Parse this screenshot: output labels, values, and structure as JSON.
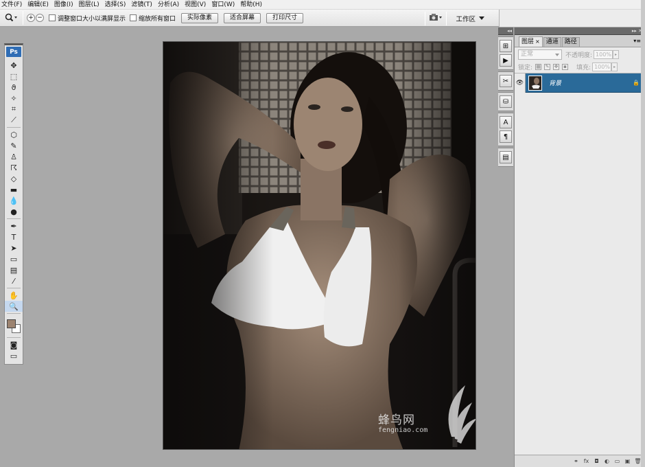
{
  "menu": [
    "文件(F)",
    "编辑(E)",
    "图像(I)",
    "图层(L)",
    "选择(S)",
    "滤镜(T)",
    "分析(A)",
    "视图(V)",
    "窗口(W)",
    "帮助(H)"
  ],
  "options": {
    "tool_icon": "zoom-icon",
    "zoom_in": "+",
    "zoom_out": "−",
    "resize_windows": "调整窗口大小以满屏显示",
    "zoom_all": "缩放所有窗口",
    "actual_pixels": "实际像素",
    "fit_screen": "适合屏幕",
    "print_size": "打印尺寸",
    "workspace": "工作区"
  },
  "toolbox": {
    "logo": "Ps",
    "tools": [
      {
        "name": "move-tool",
        "glyph": "✥"
      },
      {
        "name": "marquee-tool",
        "glyph": "⬚"
      },
      {
        "name": "lasso-tool",
        "glyph": "ϑ"
      },
      {
        "name": "magic-wand-tool",
        "glyph": "✧"
      },
      {
        "name": "crop-tool",
        "glyph": "⌗"
      },
      {
        "name": "slice-tool",
        "glyph": "⟋"
      },
      {
        "name": "healing-tool",
        "glyph": "⬡"
      },
      {
        "name": "brush-tool",
        "glyph": "✎"
      },
      {
        "name": "stamp-tool",
        "glyph": "♙"
      },
      {
        "name": "history-brush-tool",
        "glyph": "☈"
      },
      {
        "name": "eraser-tool",
        "glyph": "◇"
      },
      {
        "name": "gradient-tool",
        "glyph": "▬"
      },
      {
        "name": "blur-tool",
        "glyph": "💧"
      },
      {
        "name": "dodge-tool",
        "glyph": "●"
      },
      {
        "name": "pen-tool",
        "glyph": "✒"
      },
      {
        "name": "type-tool",
        "glyph": "T"
      },
      {
        "name": "path-selection-tool",
        "glyph": "➤"
      },
      {
        "name": "shape-tool",
        "glyph": "▭"
      },
      {
        "name": "notes-tool",
        "glyph": "▤"
      },
      {
        "name": "eyedropper-tool",
        "glyph": "⁄"
      },
      {
        "name": "hand-tool",
        "glyph": "✋"
      },
      {
        "name": "zoom-tool",
        "glyph": "🔍"
      }
    ],
    "foreground_color": "#9c8370",
    "background_color": "#ffffff"
  },
  "watermark": {
    "title": "蜂鸟网",
    "sub": "fengniao.com"
  },
  "layers_panel": {
    "tabs": [
      {
        "label": "图层",
        "active": true
      },
      {
        "label": "通道",
        "active": false
      },
      {
        "label": "路径",
        "active": false
      }
    ],
    "blend_mode": "正常",
    "opacity_label": "不透明度:",
    "opacity_value": "100%",
    "lock_label": "锁定:",
    "fill_label": "填充:",
    "fill_value": "100%",
    "layers": [
      {
        "name": "背景",
        "selected": true,
        "visible": true,
        "locked": true
      }
    ]
  },
  "dock": {
    "icons": [
      "navigator-icon",
      "actions-icon",
      "tools-preset-icon",
      "clone-source-icon",
      "character-icon",
      "paragraph-icon",
      "layer-comps-icon"
    ]
  },
  "accent_color": "#2a6a99"
}
